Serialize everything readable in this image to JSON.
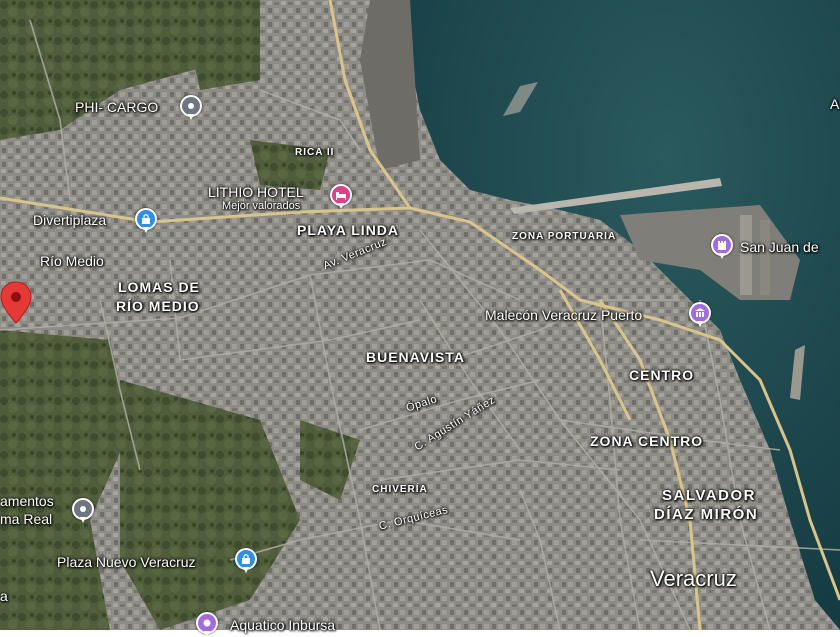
{
  "map": {
    "colors": {
      "sea": "#1c4a50",
      "sea_deep": "#10343a",
      "urban": "#8a8a86",
      "vegetation": "#4a5a36",
      "road_major": "#d8c38a",
      "road_minor": "#9a9a9a"
    },
    "neighborhoods": {
      "playa_linda": "PLAYA LINDA",
      "lomas_line1": "LOMAS DE",
      "lomas_line2": "RÍO MEDIO",
      "buenavista": "BUENAVISTA",
      "centro": "CENTRO",
      "zona_centro": "ZONA CENTRO",
      "salvador_line1": "SALVADOR",
      "salvador_line2": "DÍAZ MIRÓN",
      "zona_portuaria": "ZONA PORTUARIA",
      "rica": "RICA II",
      "chiveria": "CHIVERÍA",
      "rio_medio": "Río Medio",
      "city": "Veracruz"
    },
    "streets": {
      "av_veracruz": "Av. Veracruz",
      "opalo": "Ópalo",
      "agustin_yanez": "C. Agustín Yáñez",
      "orquideas": "C. Orquíceas"
    },
    "pois": {
      "phi_cargo": "PHI- CARGO",
      "lithio_hotel": "LITHIO HOTEL",
      "lithio_sub": "Mejor valorados",
      "divertiplaza": "Divertiplaza",
      "malecon": "Malecón Veracruz Puerto",
      "san_juan": "San Juan de",
      "plaza_nuevo": "Plaza Nuevo Veracruz",
      "aquatico": "Aquatico Inbursa",
      "departamentos_1": "amentos",
      "departamentos_2": "ma Real",
      "left_cut": "a",
      "right_cut": "A"
    }
  }
}
